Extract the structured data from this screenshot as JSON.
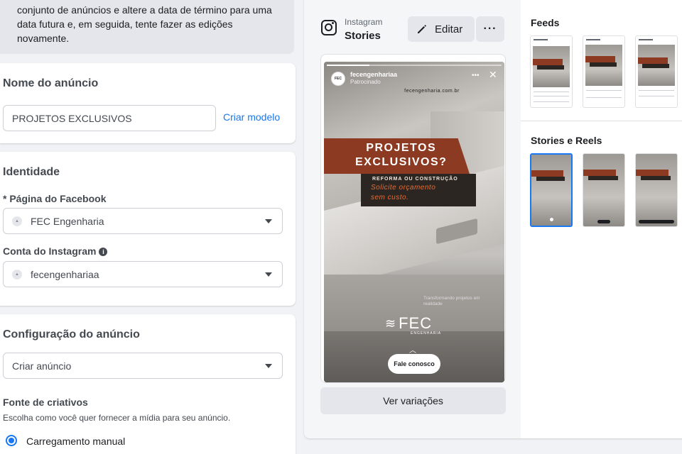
{
  "notice": {
    "text": "conjunto de anúncios e altere a data de término para uma data futura e, em seguida, tente fazer as edições novamente."
  },
  "ad_name": {
    "title": "Nome do anúncio",
    "value": "PROJETOS EXCLUSIVOS",
    "template_link": "Criar modelo"
  },
  "identity": {
    "title": "Identidade",
    "facebook_label": "* Página do Facebook",
    "facebook_page": "FEC Engenharia",
    "instagram_label": "Conta do Instagram",
    "instagram_account": "fecengenhariaa"
  },
  "ad_setup": {
    "title": "Configuração do anúncio",
    "value": "Criar anúncio",
    "creative_source_label": "Fonte de criativos",
    "creative_source_desc": "Escolha como você quer fornecer a mídia para seu anúncio.",
    "option_manual": "Carregamento manual"
  },
  "preview": {
    "platform": "Instagram",
    "placement": "Stories",
    "edit_label": "Editar",
    "more_label": "···",
    "variations_label": "Ver variações",
    "story": {
      "username": "fecengenhariaa",
      "sponsored": "Patrocinado",
      "website": "fecengenharia.com.br",
      "headline": "PROJETOS EXCLUSIVOS?",
      "headline_line1": "PROJETOS",
      "headline_line2": "EXCLUSIVOS?",
      "sub1": "REFORMA OU CONSTRUÇÃO",
      "sub2": "Solicite orçamento",
      "sub3": "sem custo.",
      "tagline": "Transformando projetos em realidade",
      "logo_text": "FEC",
      "logo_sub": "ENGENHARIA",
      "cta": "Fale conosco",
      "avatar_text": "FEC"
    },
    "sections": {
      "feeds": "Feeds",
      "stories_reels": "Stories e Reels"
    }
  },
  "colors": {
    "accent": "#1877f2",
    "banner_orange": "#8d3a22",
    "banner_dark": "#2b2622"
  }
}
